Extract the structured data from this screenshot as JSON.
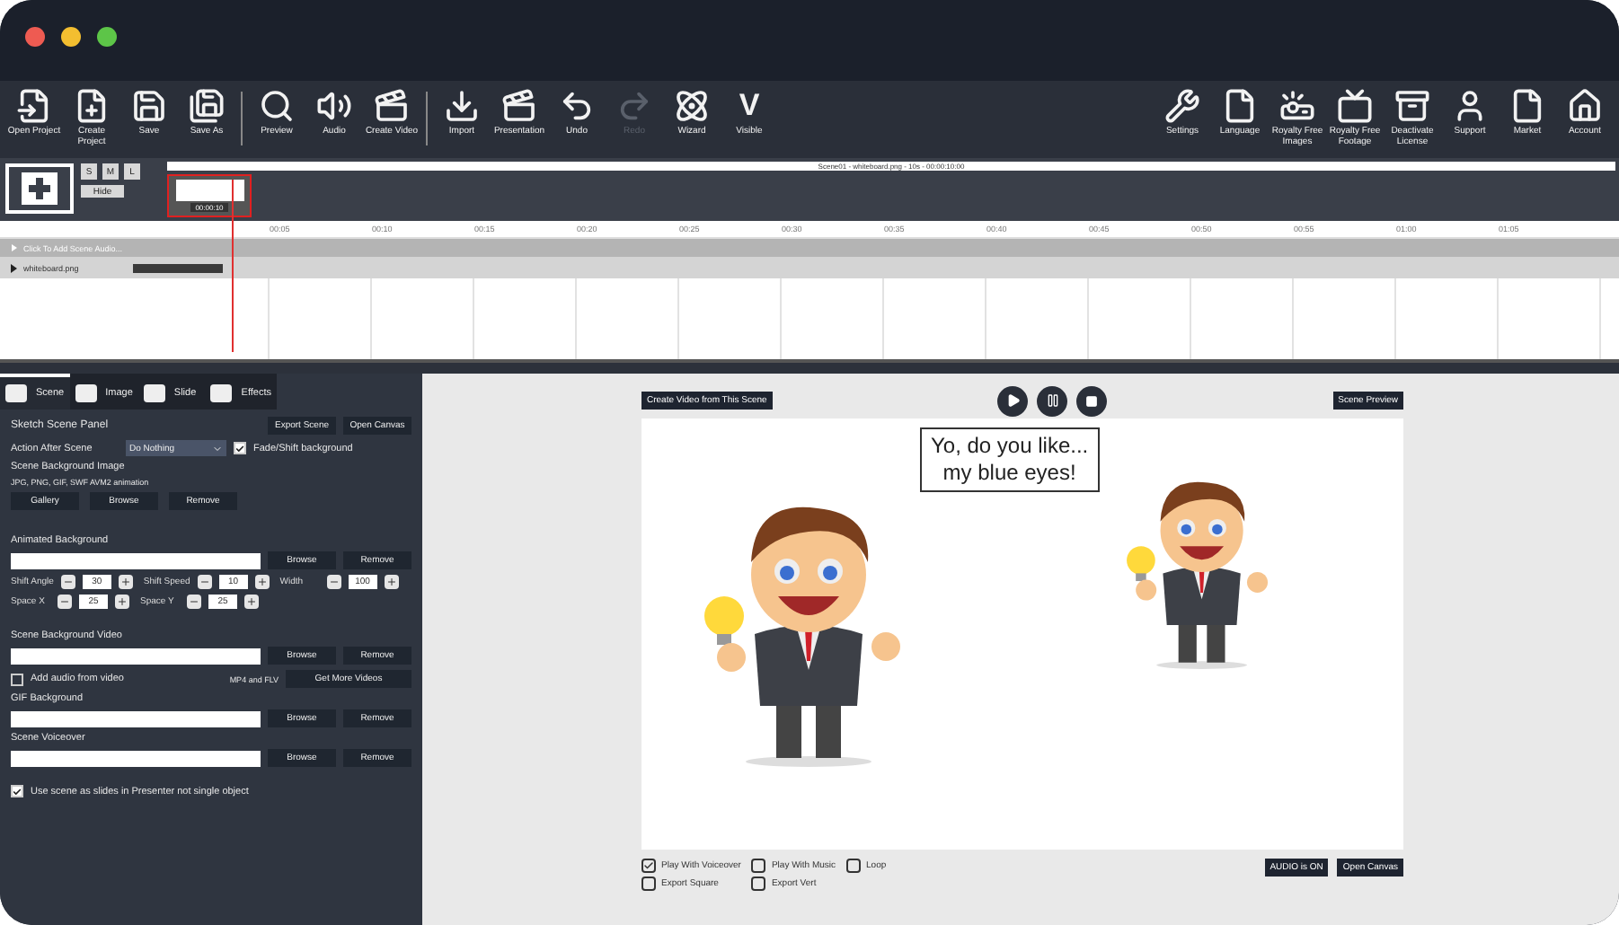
{
  "toolbar": {
    "left": [
      {
        "label": "Open Project",
        "disabled": false
      },
      {
        "label": "Create Project",
        "disabled": false
      },
      {
        "label": "Save",
        "disabled": false
      },
      {
        "label": "Save As",
        "disabled": false
      },
      {
        "label": "Preview",
        "disabled": false
      },
      {
        "label": "Audio",
        "disabled": false
      },
      {
        "label": "Create Video",
        "disabled": false
      },
      {
        "label": "Import",
        "disabled": false
      },
      {
        "label": "Presentation",
        "disabled": false
      },
      {
        "label": "Undo",
        "disabled": false
      },
      {
        "label": "Redo",
        "disabled": true
      },
      {
        "label": "Wizard",
        "disabled": false
      },
      {
        "label": "Visible",
        "glyph": "V",
        "disabled": false
      }
    ],
    "right": [
      {
        "label": "Settings"
      },
      {
        "label": "Language"
      },
      {
        "label": "Royalty Free Images"
      },
      {
        "label": "Royalty Free Footage"
      },
      {
        "label": "Deactivate License"
      },
      {
        "label": "Support"
      },
      {
        "label": "Market"
      },
      {
        "label": "Account"
      }
    ]
  },
  "timeline": {
    "size_buttons": [
      "S",
      "M",
      "L"
    ],
    "hide_button": "Hide",
    "clip_title": "Scene01 - whiteboard.png - 10s - 00:00:10:00",
    "clip_label": "00:00:10",
    "ruler": [
      "00:05",
      "00:10",
      "00:15",
      "00:20",
      "00:25",
      "00:30",
      "00:35",
      "00:40",
      "00:45",
      "00:50",
      "00:55",
      "01:00",
      "01:05"
    ],
    "audio_row": "Click To Add Scene Audio...",
    "layer": {
      "name": "whiteboard.png",
      "expanded": false
    }
  },
  "left_panel": {
    "tabs": [
      {
        "label": "Scene",
        "selected": true
      },
      {
        "label": "Image",
        "selected": false
      },
      {
        "label": "Slide",
        "selected": false
      },
      {
        "label": "Effects",
        "selected": false
      }
    ],
    "title": "Sketch Scene Panel",
    "export_button": "Export Scene",
    "open_canvas_button": "Open Canvas",
    "action_label": "Action After Scene",
    "action_value": "Do Nothing",
    "fade": {
      "label": "Fade/Shift background",
      "checked": true
    },
    "bg_image_label": "Scene Background Image",
    "bg_image_formats": "JPG, PNG, GIF, SWF AVM2 animation",
    "bg_image_buttons": [
      "Gallery",
      "Browse",
      "Remove"
    ],
    "animated_label": "Animated Background",
    "animated_buttons": [
      "Browse",
      "Remove"
    ],
    "steppers": [
      {
        "label": "Shift Angle",
        "value": "30"
      },
      {
        "label": "Shift Speed",
        "value": "10"
      },
      {
        "label": "Width",
        "value": "100"
      },
      {
        "label": "Space X",
        "value": "25"
      },
      {
        "label": "Space Y",
        "value": "25"
      }
    ],
    "video_label": "Scene Background Video",
    "video_buttons": [
      "Browse",
      "Remove"
    ],
    "add_audio": {
      "label": "Add audio from video",
      "checked": false
    },
    "video_formats": "MP4 and FLV",
    "more_videos_button": "Get More Videos",
    "gif_label": "GIF Background",
    "gif_buttons": [
      "Browse",
      "Remove"
    ],
    "voiceover_label": "Scene Voiceover",
    "voiceover_buttons": [
      "Browse",
      "Remove"
    ],
    "slides": {
      "label": "Use scene as slides in Presenter not single object",
      "checked": true
    }
  },
  "preview": {
    "create_button": "Create Video from This Scene",
    "preview_button": "Scene Preview",
    "bubble": [
      "Yo, do you like...",
      "my blue eyes!"
    ],
    "options": [
      {
        "label": "Play With Voiceover",
        "checked": true
      },
      {
        "label": "Play With Music",
        "checked": false
      },
      {
        "label": "Loop",
        "checked": false
      },
      {
        "label": "Export Square",
        "checked": false
      },
      {
        "label": "Export Vert",
        "checked": false
      }
    ],
    "audio_button": "AUDIO is ON",
    "canvas_button": "Open Canvas"
  }
}
